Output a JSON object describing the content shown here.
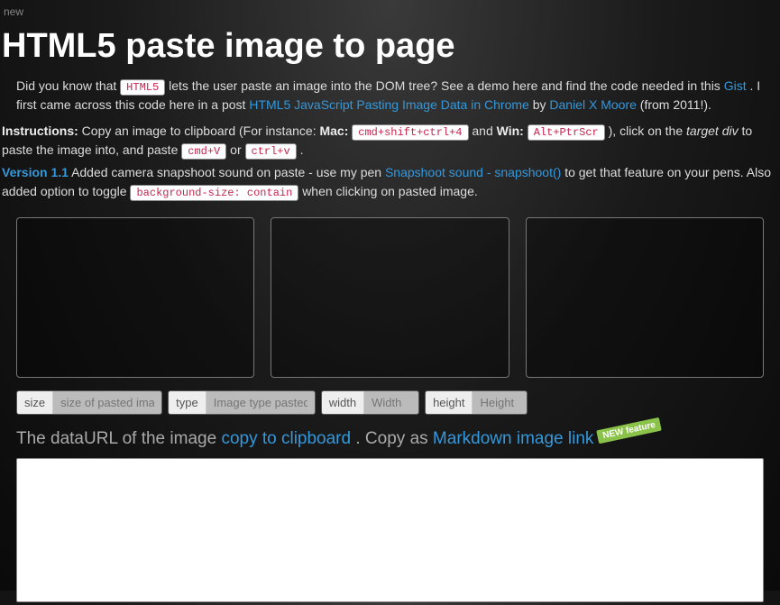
{
  "new_label": "new",
  "title": "HTML5 paste image to page",
  "intro": {
    "p1_a": "Did you know that ",
    "p1_html5": "HTML5",
    "p1_b": " lets the user paste an image into the DOM tree? See a demo here and find the code needed in this ",
    "p1_gist": "Gist",
    "p1_c": ". I first came across this code here in a post ",
    "p1_postlink": "HTML5 JavaScript Pasting Image Data in Chrome",
    "p1_by": " by ",
    "p1_author": "Daniel X Moore",
    "p1_d": " (from 2011!)."
  },
  "instructions": {
    "label": "Instructions:",
    "a": " Copy an image to clipboard (For instance: ",
    "mac_label": "Mac:",
    "mac_key": "cmd+shift+ctrl+4",
    "and": " and ",
    "win_label": "Win:",
    "win_key": "Alt+PtrScr",
    "b": "), click on the ",
    "target": "target div",
    "c": " to paste the image into, and paste ",
    "cmdv": "cmd+V",
    "or": " or ",
    "ctrlv": "ctrl+v",
    "d": "."
  },
  "version_line": {
    "ver": "Version 1.1",
    "a": " Added camera snapshoot sound on paste - use my pen ",
    "snaplink": "Snapshoot sound - snapshoot()",
    "b": " to get that feature on your pens. Also added option to toggle ",
    "bgcode": "background-size: contain",
    "c": " when clicking on pasted image."
  },
  "fields": {
    "size_label": "size",
    "size_ph": "size of pasted image",
    "type_label": "type",
    "type_ph": "Image type pasted",
    "width_label": "width",
    "width_ph": "Width",
    "height_label": "height",
    "height_ph": "Height"
  },
  "dataurl": {
    "a": "The dataURL of the image ",
    "copy": "copy to clipboard",
    "b": ". Copy as ",
    "mdlink": "Markdown image link",
    "badge": "NEW feature"
  }
}
